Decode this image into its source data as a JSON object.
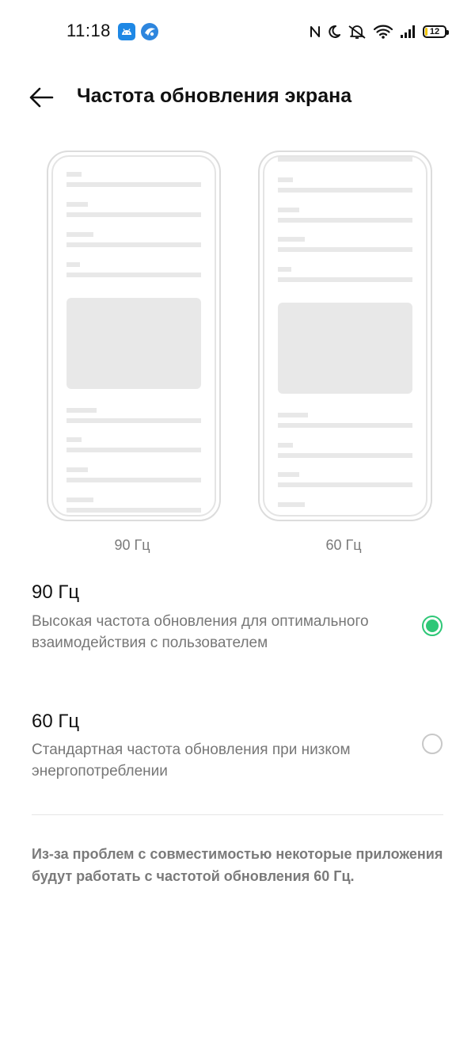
{
  "status_bar": {
    "time": "11:18",
    "battery_level": "12",
    "icons": [
      "android-app-icon",
      "browser-app-icon",
      "nfc-icon",
      "moon-icon",
      "bell-muted-icon",
      "wifi-icon",
      "signal-icon",
      "battery-icon"
    ]
  },
  "header": {
    "back_icon": "back-arrow-icon",
    "title": "Частота обновления экрана"
  },
  "previews": [
    {
      "label": "90 Гц"
    },
    {
      "label": "60 Гц"
    }
  ],
  "options": [
    {
      "title": "90 Гц",
      "description": "Высокая частота обновления для оптимального взаимодействия с пользователем",
      "selected": true
    },
    {
      "title": "60 Гц",
      "description": "Стандартная частота обновления при низком энергопотреблении",
      "selected": false
    }
  ],
  "footnote": "Из-за проблем с совместимостью некоторые приложения будут работать с частотой обновления 60 Гц.",
  "colors": {
    "accent": "#2fc777",
    "secondary_text": "#777777",
    "skeleton": "#e8e8e8"
  }
}
